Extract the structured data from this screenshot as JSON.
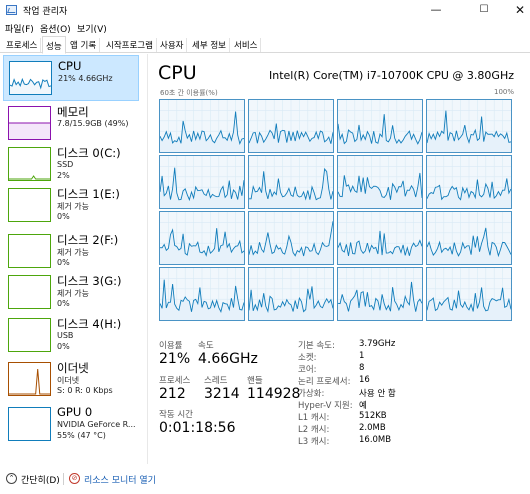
{
  "window": {
    "title": "작업 관리자",
    "controls": {
      "minimize": "—",
      "maximize": "☐",
      "close": "✕"
    }
  },
  "menu": [
    "파일(F)",
    "옵션(O)",
    "보기(V)"
  ],
  "tabs": [
    "프로세스",
    "성능",
    "앱 기록",
    "시작프로그램",
    "사용자",
    "세부 정보",
    "서비스"
  ],
  "active_tab": "성능",
  "sidebar": [
    {
      "title": "CPU",
      "sub1": "21% 4.66GHz",
      "sub2": "",
      "color": "#117dbb",
      "graph": "cpu"
    },
    {
      "title": "메모리",
      "sub1": "7.8/15.9GB (49%)",
      "sub2": "",
      "color": "#8b12ae",
      "graph": "memory"
    },
    {
      "title": "디스크 0(C:)",
      "sub1": "SSD",
      "sub2": "2%",
      "color": "#4da60c",
      "graph": "disk"
    },
    {
      "title": "디스크 1(E:)",
      "sub1": "제거 가능",
      "sub2": "0%",
      "color": "#4da60c",
      "graph": "none"
    },
    {
      "title": "디스크 2(F:)",
      "sub1": "제거 가능",
      "sub2": "0%",
      "color": "#4da60c",
      "graph": "none"
    },
    {
      "title": "디스크 3(G:)",
      "sub1": "제거 가능",
      "sub2": "0%",
      "color": "#4da60c",
      "graph": "none"
    },
    {
      "title": "디스크 4(H:)",
      "sub1": "USB",
      "sub2": "0%",
      "color": "#4da60c",
      "graph": "none"
    },
    {
      "title": "이더넷",
      "sub1": "이더넷",
      "sub2": "S: 0  R: 0 Kbps",
      "color": "#a74f01",
      "graph": "ethernet"
    },
    {
      "title": "GPU 0",
      "sub1": "NVIDIA GeForce R...",
      "sub2": "55% (47 °C)",
      "color": "#117dbb",
      "graph": "none"
    }
  ],
  "cpu": {
    "title": "CPU",
    "model": "Intel(R) Core(TM) i7-10700K CPU @ 3.80GHz",
    "graph_caption": "60초 간 이용률(%)",
    "graph_max": "100%",
    "core_count_shown": 16,
    "stats": {
      "usage_label": "이용률",
      "usage_value": "21%",
      "speed_label": "속도",
      "speed_value": "4.66GHz",
      "processes_label": "프로세스",
      "processes_value": "212",
      "threads_label": "스레드",
      "threads_value": "3214",
      "handles_label": "핸들",
      "handles_value": "114928",
      "uptime_label": "작동 시간",
      "uptime_value": "0:01:18:56"
    },
    "specs": [
      {
        "label": "기본 속도:",
        "value": "3.79GHz"
      },
      {
        "label": "소켓:",
        "value": "1"
      },
      {
        "label": "코어:",
        "value": "8"
      },
      {
        "label": "논리 프로세서:",
        "value": "16"
      },
      {
        "label": "가상화:",
        "value": "사용 안 함"
      },
      {
        "label": "Hyper-V 지원:",
        "value": "예"
      },
      {
        "label": "L1 캐시:",
        "value": "512KB"
      },
      {
        "label": "L2 캐시:",
        "value": "2.0MB"
      },
      {
        "label": "L3 캐시:",
        "value": "16.0MB"
      }
    ]
  },
  "footer": {
    "summary": "간단히(D)",
    "resource_monitor": "리소스 모니터 열기"
  },
  "colors": {
    "cpu_line": "#117dbb",
    "cpu_fill": "#f1f7fc",
    "memory": "#8b12ae",
    "disk": "#4da60c",
    "ethernet": "#a74f01",
    "selected_bg": "#cce8ff"
  }
}
